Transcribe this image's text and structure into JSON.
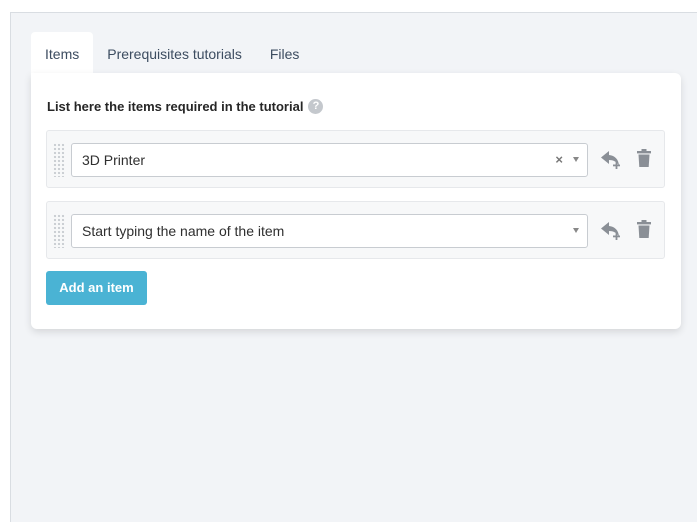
{
  "tabs": [
    {
      "label": "Items",
      "active": true
    },
    {
      "label": "Prerequisites tutorials",
      "active": false
    },
    {
      "label": "Files",
      "active": false
    }
  ],
  "section": {
    "title": "List here the items required in the tutorial",
    "help_icon": "question-circle-icon",
    "help_glyph": "?"
  },
  "items": [
    {
      "value": "3D Printer",
      "clear_glyph": "×",
      "has_clear": true
    },
    {
      "value": "",
      "placeholder": "Start typing the name of the item",
      "has_clear": false
    }
  ],
  "add_button": {
    "label": "Add an item"
  },
  "colors": {
    "accent": "#4ab3d4",
    "background": "#f2f4f7",
    "card": "#ffffff",
    "icon": "#8a8f96"
  }
}
